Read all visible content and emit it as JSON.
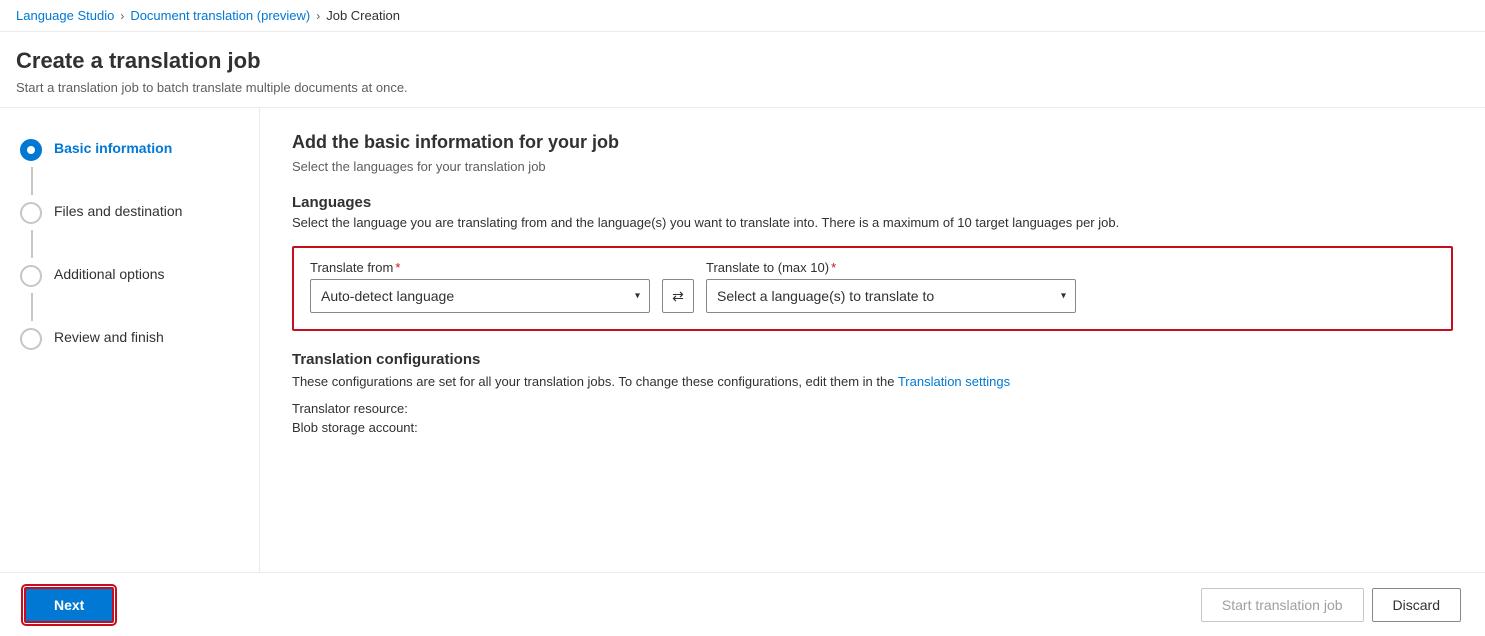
{
  "breadcrumb": {
    "items": [
      {
        "label": "Language Studio",
        "href": "#"
      },
      {
        "label": "Document translation (preview)",
        "href": "#"
      },
      {
        "label": "Job Creation",
        "current": true
      }
    ],
    "separators": [
      ">",
      ">"
    ]
  },
  "page": {
    "title": "Create a translation job",
    "description": "Start a translation job to batch translate multiple documents at once."
  },
  "sidebar": {
    "steps": [
      {
        "label": "Basic information",
        "active": true
      },
      {
        "label": "Files and destination",
        "active": false
      },
      {
        "label": "Additional options",
        "active": false
      },
      {
        "label": "Review and finish",
        "active": false
      }
    ]
  },
  "content": {
    "heading": "Add the basic information for your job",
    "subtitle": "Select the languages for your translation job",
    "languages_section": {
      "title": "Languages",
      "description": "Select the language you are translating from and the language(s) you want to translate into. There is a maximum of 10 target languages per job.",
      "translate_from_label": "Translate from",
      "translate_from_required": "*",
      "translate_from_placeholder": "Auto-detect language",
      "translate_to_label": "Translate to (max 10)",
      "translate_to_required": "*",
      "translate_to_placeholder": "Select a language(s) to translate to",
      "swap_icon": "⇄"
    },
    "config_section": {
      "title": "Translation configurations",
      "description_prefix": "These configurations are set for all your translation jobs. To change these configurations, edit them in the ",
      "link_text": "Translation settings",
      "description_suffix": "",
      "rows": [
        {
          "label": "Translator resource:"
        },
        {
          "label": "Blob storage account:"
        }
      ]
    }
  },
  "footer": {
    "next_label": "Next",
    "start_label": "Start translation job",
    "discard_label": "Discard"
  }
}
